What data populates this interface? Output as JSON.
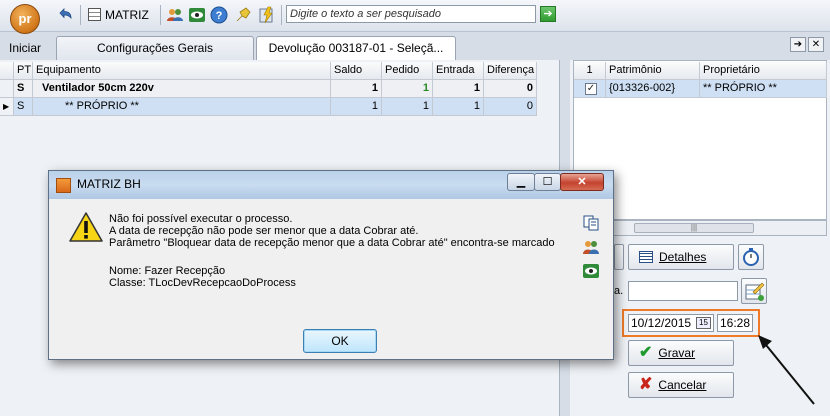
{
  "toolbar": {
    "iniciar_label": "Iniciar",
    "logo_text": "pr",
    "matriz_label": "MATRIZ",
    "search_placeholder": "Digite o texto a ser pesquisado"
  },
  "tabs": [
    {
      "label": "Configurações Gerais"
    },
    {
      "label": "Devolução 003187-01 - Seleçã..."
    }
  ],
  "left_grid": {
    "columns": [
      "PT",
      "Equipamento",
      "Saldo",
      "Pedido",
      "Entrada",
      "Diferença"
    ],
    "rows": [
      {
        "pt": "S",
        "equipamento": "Ventilador 50cm 220v",
        "saldo": "1",
        "pedido": "1",
        "entrada": "1",
        "diferenca": "0"
      },
      {
        "pt": "S",
        "equipamento": "** PRÓPRIO **",
        "saldo": "1",
        "pedido": "1",
        "entrada": "1",
        "diferenca": "0"
      }
    ]
  },
  "right_grid": {
    "columns": [
      "1",
      "Patrimônio",
      "Proprietário"
    ],
    "rows": [
      {
        "patrimonio": "{013326-002}",
        "proprietario": "** PRÓPRIO **"
      }
    ]
  },
  "right_panel": {
    "detalhes_label": "Detalhes",
    "field_suffix": "a.",
    "date_value": "10/12/2015",
    "date_button": "15",
    "time_value": "16:28",
    "gravar_label": "Gravar",
    "cancelar_label": "Cancelar"
  },
  "dialog": {
    "title": "MATRIZ BH",
    "line1": "Não foi possível executar o processo.",
    "line2": "A data de recepção não pode ser menor que a data Cobrar até.",
    "line3": "Parâmetro \"Bloquear data de recepção menor que a data Cobrar até\" encontra-se marcado",
    "line4": "Nome: Fazer Recepção",
    "line5": "Classe: TLocDevRecepcaoDoProcess",
    "ok_label": "OK"
  }
}
